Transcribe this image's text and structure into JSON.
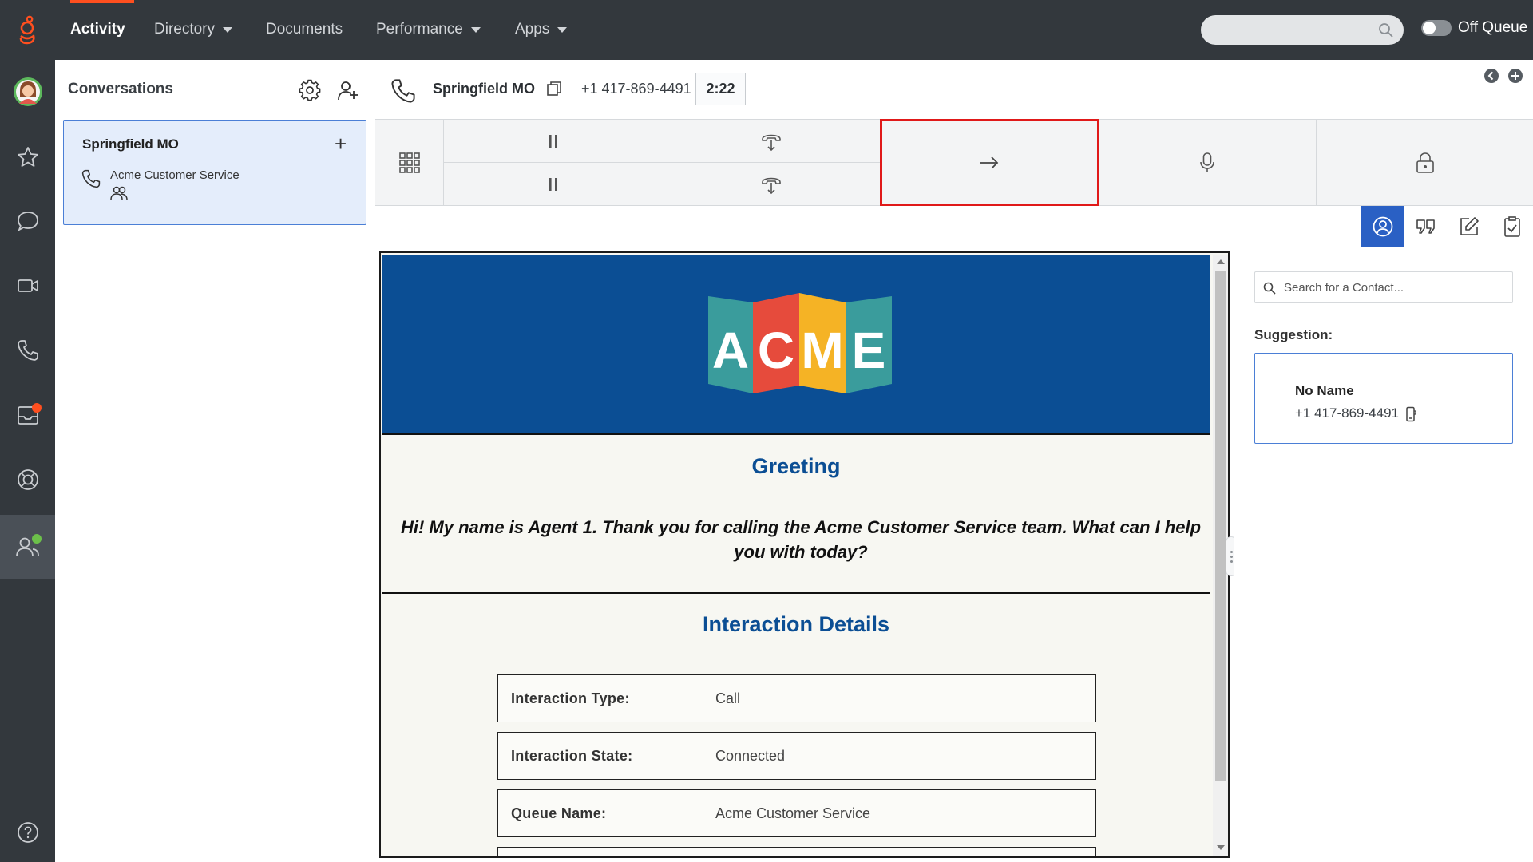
{
  "nav": {
    "items": [
      {
        "label": "Activity"
      },
      {
        "label": "Directory"
      },
      {
        "label": "Documents"
      },
      {
        "label": "Performance"
      },
      {
        "label": "Apps"
      }
    ],
    "queue_status": "Off Queue"
  },
  "colors": {
    "topbar": "#33383d",
    "accent": "#ff4f1f",
    "active_blue": "#2a60c4",
    "script_blue": "#0b4e94",
    "highlight_red": "#e01919"
  },
  "conversations": {
    "title": "Conversations",
    "card": {
      "title": "Springfield MO",
      "queue": "Acme Customer Service"
    }
  },
  "call": {
    "title": "Springfield MO",
    "number": "+1 417-869-4491",
    "timer": "2:22"
  },
  "toolbar": {
    "icons": [
      "dialpad-icon",
      "hold-icon",
      "consult-icon",
      "transfer-icon",
      "mute-icon",
      "secure-pause-icon"
    ]
  },
  "script": {
    "logo_letters": [
      "A",
      "C",
      "M",
      "E"
    ],
    "greeting_title": "Greeting",
    "greeting_text": "Hi! My name is Agent 1. Thank you for calling the Acme Customer Service team. What can I help you with today?",
    "details_title": "Interaction Details",
    "details": [
      {
        "label": "Interaction Type:",
        "value": "Call"
      },
      {
        "label": "Interaction State:",
        "value": "Connected"
      },
      {
        "label": "Queue Name:",
        "value": "Acme Customer Service"
      }
    ]
  },
  "contacts": {
    "search_placeholder": "Search for a Contact...",
    "suggestion_label": "Suggestion:",
    "suggestion": {
      "name": "No Name",
      "number": "+1 417-869-4491"
    }
  }
}
